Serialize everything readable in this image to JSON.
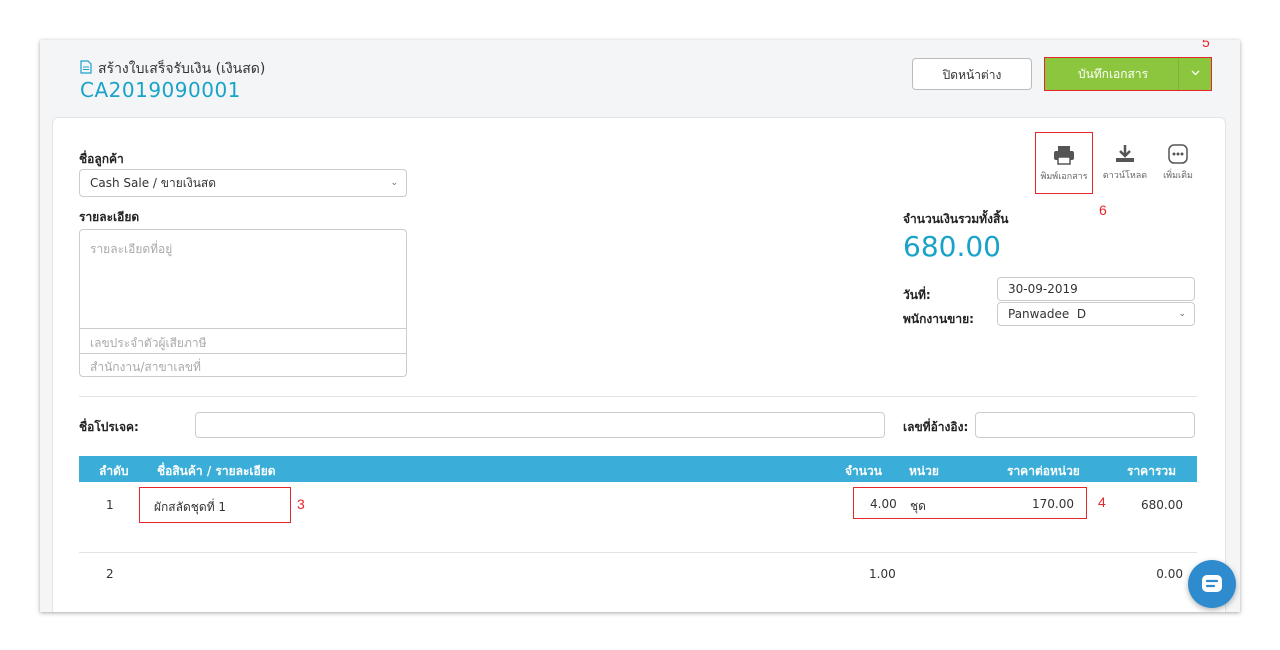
{
  "header": {
    "subtitle": "สร้างใบเสร็จรับเงิน (เงินสด)",
    "doc_number": "CA2019090001",
    "close_label": "ปิดหน้าต่าง",
    "save_label": "บันทึกเอกสาร"
  },
  "callouts": {
    "c5": "5",
    "c6": "6",
    "c3": "3",
    "c4": "4"
  },
  "customer": {
    "label": "ชื่อลูกค้า",
    "selected": "Cash Sale / ขายเงินสด",
    "details_label": "รายละเอียด",
    "address_placeholder": "รายละเอียดที่อยู่",
    "taxid_placeholder": "เลขประจำตัวผู้เสียภาษี",
    "branch_placeholder": "สำนักงาน/สาขาเลขที่"
  },
  "tools": {
    "print": "พิมพ์เอกสาร",
    "download": "ดาวน์โหลด",
    "more": "เพิ่มเติม"
  },
  "summary": {
    "total_label": "จำนวนเงินรวมทั้งสิ้น",
    "total_value": "680.00",
    "date_label": "วันที่:",
    "date_value": "30-09-2019",
    "salesperson_label": "พนักงานขาย:",
    "salesperson_value": "Panwadee  D"
  },
  "project": {
    "label": "ชื่อโปรเจค:",
    "ref_label": "เลขที่อ้างอิง:"
  },
  "table": {
    "headers": {
      "no": "ลำดับ",
      "name": "ชื่อสินค้า / รายละเอียด",
      "qty": "จำนวน",
      "unit": "หน่วย",
      "price": "ราคาต่อหน่วย",
      "total": "ราคารวม"
    },
    "rows": [
      {
        "no": "1",
        "name": "ผักสลัดชุดที่ 1",
        "qty": "4.00",
        "unit": "ชุด",
        "price": "170.00",
        "total": "680.00"
      },
      {
        "no": "2",
        "name": "",
        "qty": "1.00",
        "unit": "",
        "price": "",
        "total": "0.00"
      }
    ]
  },
  "icons": [
    "document-icon",
    "chevron-down-icon",
    "print-icon",
    "download-icon",
    "more-icon",
    "chat-icon"
  ],
  "colors": {
    "accent": "#1aa3c8",
    "save": "#8cc63f",
    "table_header": "#3aaed8",
    "callout": "#e5262b",
    "chat": "#2e8bce"
  }
}
